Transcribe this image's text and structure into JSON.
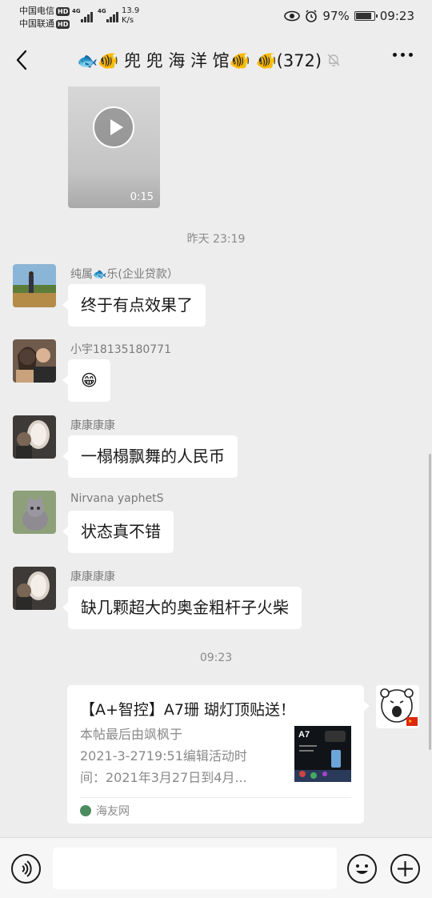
{
  "status_bar": {
    "carrier_1": "中国电信",
    "carrier_2": "中国联通",
    "hd_label": "HD",
    "network_label": "4G",
    "speed_value": "13.9",
    "speed_unit": "K/s",
    "battery_percent": "97%",
    "battery_level": 0.97,
    "time": "09:23"
  },
  "nav": {
    "title": "🐟🐠 兜 兜 海 洋 馆🐠 🐠(372)",
    "icons": [
      "back-icon",
      "mute-bell-icon",
      "more-icon"
    ]
  },
  "messages": {
    "video_duration": "0:15",
    "time_yesterday": "昨天 23:19",
    "m1_sender": "纯属🐟乐(企业贷款）",
    "m1_text": "终于有点效果了",
    "m2_sender": "小宇18135180771",
    "m2_text": "😁",
    "m3_sender": "康康康康",
    "m3_text": "一榻榻飘舞的人民币",
    "m4_sender": "Nirvana yaphetS",
    "m4_text": "状态真不错",
    "m5_sender": "康康康康",
    "m5_text": "缺几颗超大的奥金粗杆子火柴",
    "time_today": "09:23"
  },
  "card": {
    "title": "【A+智控】A7珊 瑚灯顶贴送！",
    "desc_line1": "本帖最后由飒枫于",
    "desc_line2": "2021-3-2719:51编辑活动时",
    "desc_line3": "间：2021年3月27日到4月...",
    "thumb_label": "A7",
    "source": "海友网"
  },
  "input_bar": {
    "icons": [
      "voice-icon",
      "emoji-icon",
      "plus-icon"
    ]
  }
}
